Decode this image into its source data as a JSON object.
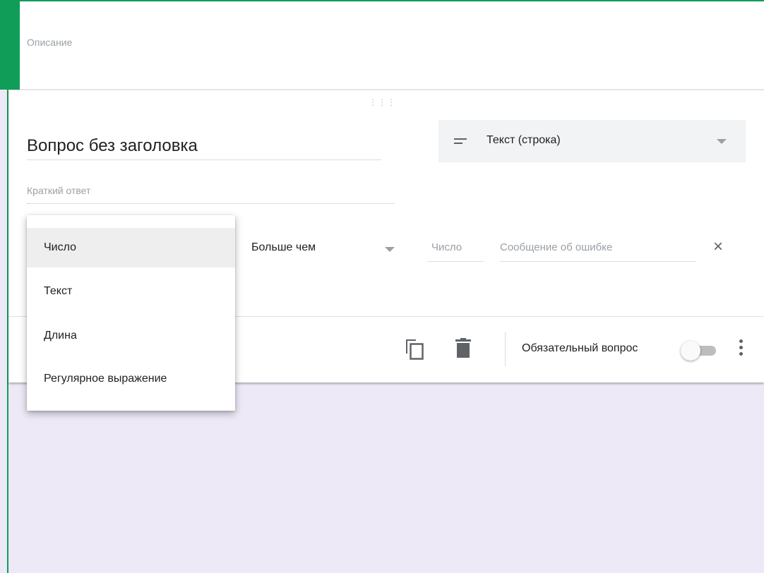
{
  "description_card": {
    "placeholder": "Описание"
  },
  "question": {
    "title": "Вопрос без заголовка",
    "answer_placeholder": "Краткий ответ",
    "type_select": {
      "icon": "short-text-icon",
      "label": "Текст (строка)"
    }
  },
  "validation": {
    "condition": "Больше чем",
    "number_placeholder": "Число",
    "error_placeholder": "Сообщение об ошибке",
    "close_icon": "×"
  },
  "validation_type_menu": {
    "items": [
      "Число",
      "Текст",
      "Длина",
      "Регулярное выражение"
    ],
    "selected": "Число"
  },
  "footer": {
    "required_label": "Обязательный вопрос",
    "required_on": false
  },
  "colors": {
    "accent": "#0f9d58",
    "background": "#ede9f6"
  }
}
